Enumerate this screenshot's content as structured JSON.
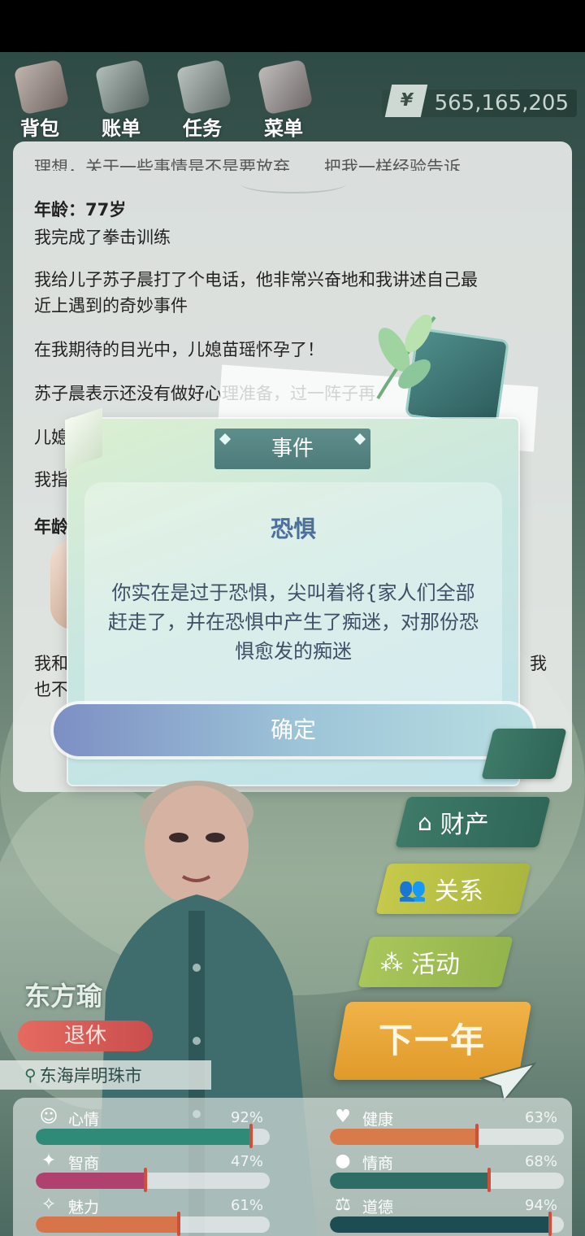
{
  "nav": {
    "items": [
      {
        "label": "背包",
        "icon": "bag-icon"
      },
      {
        "label": "账单",
        "icon": "bill-icon"
      },
      {
        "label": "任务",
        "icon": "task-icon"
      },
      {
        "label": "菜单",
        "icon": "menu-icon"
      }
    ],
    "money": {
      "symbol": "¥",
      "value": "565,165,205"
    }
  },
  "log": {
    "cut_line": "理想，关于一些事情是不是要放弃……把我一样经验告诉",
    "age_label": "年龄：77岁",
    "entries": [
      "我完成了拳击训练",
      "我给儿子苏子晨打了个电话，他非常兴奋地和我讲述自己最",
      "近上遇到的奇妙事件",
      "在我期待的目光中，儿媳苗瑶怀孕了！",
      "苏子晨表示还没有做好心理准备，过一阵子再",
      "儿媳苗",
      "我指",
      "年龄",
      "我和",
      "也不"
    ],
    "trailing": "我"
  },
  "modal": {
    "tag": "事件",
    "title": "恐惧",
    "message": "你实在是过于恐惧，尖叫着将{家人们全部赶走了，并在恐惧中产生了痴迷，对那份恐惧愈发的痴迷",
    "confirm": "确定"
  },
  "side_menu": {
    "assets": "财产",
    "relations": "关系",
    "activities": "活动",
    "next_year": "下一年"
  },
  "character": {
    "name": "东方瑜",
    "job": "退休",
    "location": "东海岸明珠市"
  },
  "stats": [
    {
      "name": "心情",
      "pct": "92%",
      "value": 0.92,
      "color": "#2f8a78",
      "icon": "smile-icon",
      "glyph": "☺"
    },
    {
      "name": "健康",
      "pct": "63%",
      "value": 0.63,
      "color": "#d97a4a",
      "icon": "heart-icon",
      "glyph": "♥"
    },
    {
      "name": "智商",
      "pct": "47%",
      "value": 0.47,
      "color": "#b0406e",
      "icon": "bulb-icon",
      "glyph": "✦"
    },
    {
      "name": "情商",
      "pct": "68%",
      "value": 0.68,
      "color": "#2e6c66",
      "icon": "apple-icon",
      "glyph": "●"
    },
    {
      "name": "魅力",
      "pct": "61%",
      "value": 0.61,
      "color": "#d8744a",
      "icon": "star-icon",
      "glyph": "✧"
    },
    {
      "name": "道德",
      "pct": "94%",
      "value": 0.94,
      "color": "#1d4d52",
      "icon": "scale-icon",
      "glyph": "⚖"
    }
  ]
}
